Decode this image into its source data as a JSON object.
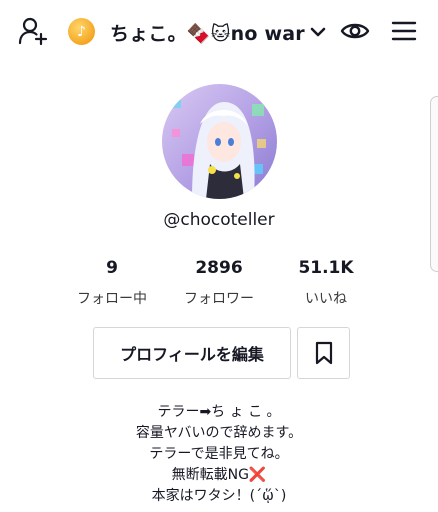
{
  "header": {
    "title": "ちょこ。🍫🐱no war",
    "coin_glyph": "♪",
    "icons": [
      "add-user-icon",
      "coin-icon",
      "chevron-down-icon",
      "eye-icon",
      "hamburger-menu-icon"
    ]
  },
  "profile": {
    "username": "@chocoteller",
    "stats": [
      {
        "value": "9",
        "label": "フォロー中"
      },
      {
        "value": "2896",
        "label": "フォロワー"
      },
      {
        "value": "51.1K",
        "label": "いいね"
      }
    ]
  },
  "actions": {
    "edit_label": "プロフィールを編集"
  },
  "bio": [
    "テラー➡ち ょ こ 。",
    "容量ヤバいので辞めます。",
    "テラーで是非見てね。",
    "無断転載NG❌",
    "本家はワタシ！(´ᾥ`)"
  ],
  "colors": {
    "text": "#161823",
    "border": "#d6d6d6",
    "coin": "#f5a623"
  }
}
